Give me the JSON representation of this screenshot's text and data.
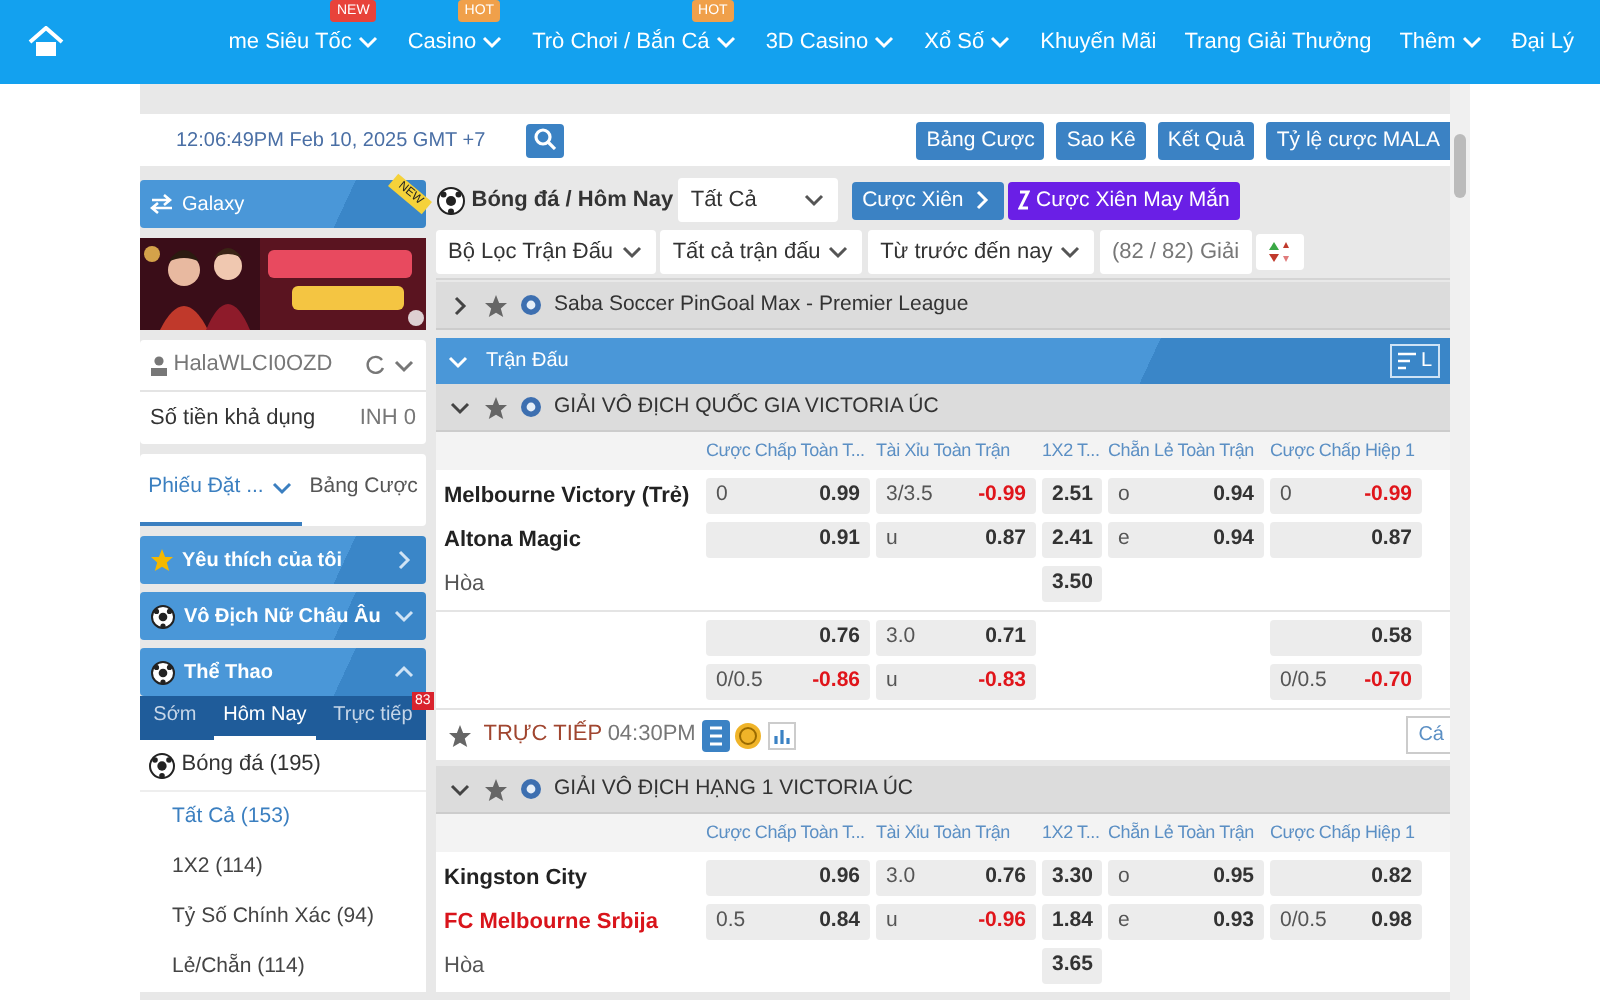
{
  "nav": {
    "items": [
      {
        "label": "me Siêu Tốc",
        "badge": "NEW",
        "color": "#e8433a"
      },
      {
        "label": "Casino",
        "badge": "HOT",
        "color": "#f0a04a"
      },
      {
        "label": "Trò Chơi / Bắn Cá",
        "badge": "HOT",
        "color": "#f0a04a"
      },
      {
        "label": "3D Casino"
      },
      {
        "label": "Xổ Số"
      }
    ],
    "right": [
      {
        "label": "Khuyến Mãi",
        "caret": false
      },
      {
        "label": "Trang Giải Thưởng",
        "caret": false
      },
      {
        "label": "Thêm",
        "caret": true
      },
      {
        "label": "Đại Lý",
        "caret": false
      }
    ]
  },
  "toolbar": {
    "clock": "12:06:49PM Feb 10, 2025 GMT +7",
    "buttons": [
      "Bảng Cược",
      "Sao Kê",
      "Kết Quả",
      "Tỷ lệ cược MALA"
    ]
  },
  "sidebar": {
    "galaxy": {
      "label": "Galaxy",
      "badge": "NEW"
    },
    "account": {
      "user": "HalaWLCI0OZD",
      "balance_label": "Số tiền khả dụng",
      "balance": "INH 0"
    },
    "slip_tabs": [
      {
        "label": "Phiếu Đặt ...",
        "selected": true
      },
      {
        "label": "Bảng Cược",
        "selected": false
      }
    ],
    "sections": [
      {
        "label": "Yêu thích của tôi",
        "kind": "link"
      },
      {
        "label": "Vô Địch Nữ Châu Âu",
        "kind": "group",
        "expanded": false
      },
      {
        "label": "Thể Thao",
        "kind": "group",
        "expanded": true
      }
    ],
    "sport_tabs": [
      {
        "label": "Sớm",
        "selected": false
      },
      {
        "label": "Hôm Nay",
        "selected": true
      },
      {
        "label": "Trực tiếp",
        "selected": false,
        "badge": "83"
      }
    ],
    "sport": {
      "label": "Bóng đá",
      "count": "(195)"
    },
    "markets": [
      {
        "label": "Tất Cả (153)",
        "selected": true
      },
      {
        "label": "1X2 (114)",
        "selected": false
      },
      {
        "label": "Tỷ Số Chính Xác (94)",
        "selected": false
      },
      {
        "label": "Lẻ/Chẵn (114)",
        "selected": false
      }
    ]
  },
  "main": {
    "title": "Bóng đá / Hôm Nay",
    "select": "Tất Cả",
    "parlay": "Cược Xiên",
    "lucky": "Cược Xiên May Mắn",
    "filters": [
      "Bộ Lọc Trận Đấu",
      "Tất cả trận đấu",
      "Từ trước đến nay"
    ],
    "count": "(82 / 82) Giải",
    "top_league": {
      "name": "Saba Soccer PinGoal Max - Premier League",
      "expanded": false
    },
    "section_bar": {
      "label": "Trận Đấu",
      "button": "L"
    },
    "leagues": [
      {
        "name": "GIẢI VÔ ĐỊCH QUỐC GIA VICTORIA ÚC",
        "expanded": true,
        "columns": [
          "Cược Chấp Toàn T...",
          "Tài Xỉu Toàn Trận",
          "1X2 T...",
          "Chẵn Lẻ Toàn Trận",
          "Cược Chấp Hiệp 1"
        ],
        "groups": [
          [
            {
              "team": "Melbourne Victory (Trẻ)",
              "kind": "team",
              "favorite": false,
              "cells": [
                {
                  "label": "0",
                  "value": "0.99",
                  "negative": false
                },
                {
                  "label": "3/3.5",
                  "value": "-0.99",
                  "negative": true
                },
                {
                  "value": "2.51",
                  "negative": false
                },
                {
                  "label": "o",
                  "value": "0.94",
                  "negative": false
                },
                {
                  "label": "0",
                  "value": "-0.99",
                  "negative": true
                }
              ]
            },
            {
              "team": "Altona Magic",
              "kind": "team",
              "favorite": false,
              "cells": [
                {
                  "value": "0.91",
                  "negative": false
                },
                {
                  "label": "u",
                  "value": "0.87",
                  "negative": false
                },
                {
                  "value": "2.41",
                  "negative": false
                },
                {
                  "label": "e",
                  "value": "0.94",
                  "negative": false
                },
                {
                  "value": "0.87",
                  "negative": false
                }
              ]
            },
            {
              "team": "Hòa",
              "kind": "draw",
              "cells": [
                null,
                null,
                {
                  "value": "3.50",
                  "negative": false
                },
                null,
                null
              ]
            }
          ],
          [
            {
              "cells": [
                {
                  "value": "0.76",
                  "negative": false
                },
                {
                  "label": "3.0",
                  "value": "0.71",
                  "negative": false
                },
                null,
                null,
                {
                  "value": "0.58",
                  "negative": false
                }
              ]
            },
            {
              "cells": [
                {
                  "label": "0/0.5",
                  "value": "-0.86",
                  "negative": true
                },
                {
                  "label": "u",
                  "value": "-0.83",
                  "negative": true
                },
                null,
                null,
                {
                  "label": "0/0.5",
                  "value": "-0.70",
                  "negative": true
                }
              ]
            }
          ]
        ],
        "footer": {
          "live": "TRỰC TIẾP",
          "time": "04:30PM",
          "action": "Cá"
        }
      },
      {
        "name": "GIẢI VÔ ĐỊCH HẠNG 1 VICTORIA ÚC",
        "expanded": true,
        "columns": [
          "Cược Chấp Toàn T...",
          "Tài Xỉu Toàn Trận",
          "1X2 T...",
          "Chẵn Lẻ Toàn Trận",
          "Cược Chấp Hiệp 1"
        ],
        "groups": [
          [
            {
              "team": "Kingston City",
              "kind": "team",
              "favorite": false,
              "cells": [
                {
                  "value": "0.96",
                  "negative": false
                },
                {
                  "label": "3.0",
                  "value": "0.76",
                  "negative": false
                },
                {
                  "value": "3.30",
                  "negative": false
                },
                {
                  "label": "o",
                  "value": "0.95",
                  "negative": false
                },
                {
                  "value": "0.82",
                  "negative": false
                }
              ]
            },
            {
              "team": "FC Melbourne Srbija",
              "kind": "team",
              "favorite": true,
              "cells": [
                {
                  "label": "0.5",
                  "value": "0.84",
                  "negative": false
                },
                {
                  "label": "u",
                  "value": "-0.96",
                  "negative": true
                },
                {
                  "value": "1.84",
                  "negative": false
                },
                {
                  "label": "e",
                  "value": "0.93",
                  "negative": false
                },
                {
                  "label": "0/0.5",
                  "value": "0.98",
                  "negative": false
                }
              ]
            },
            {
              "team": "Hòa",
              "kind": "draw",
              "cells": [
                null,
                null,
                {
                  "value": "3.65",
                  "negative": false
                },
                null,
                null
              ]
            }
          ]
        ]
      }
    ]
  }
}
